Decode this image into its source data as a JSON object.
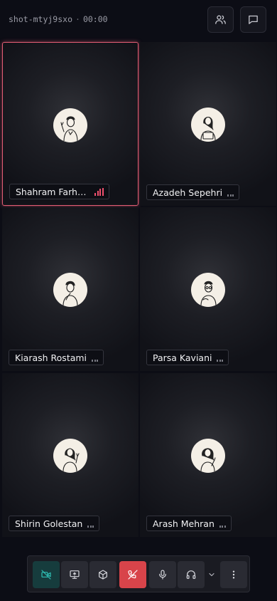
{
  "header": {
    "meeting_id": "shot-mtyj9sxo",
    "separator": "·",
    "elapsed": "00:00",
    "participants_button_icon": "users-icon",
    "chat_button_icon": "chat-bubble-icon"
  },
  "participants": [
    {
      "name": "Shahram Farhadi",
      "display": "Shahram Farha...",
      "speaking": true,
      "audio_level": 0.75,
      "avatar": "man-waving-illustration"
    },
    {
      "name": "Azadeh Sepehri",
      "display": "Azadeh Sepehri",
      "speaking": false,
      "audio_level": 0,
      "avatar": "woman-with-laptop-illustration"
    },
    {
      "name": "Kiarash Rostami",
      "display": "Kiarash Rostami",
      "speaking": false,
      "audio_level": 0,
      "avatar": "man-thinking-illustration"
    },
    {
      "name": "Parsa Kaviani",
      "display": "Parsa Kaviani",
      "speaking": false,
      "audio_level": 0,
      "avatar": "man-with-glasses-illustration"
    },
    {
      "name": "Shirin Golestan",
      "display": "Shirin Golestan",
      "speaking": false,
      "audio_level": 0,
      "avatar": "woman-waving-illustration"
    },
    {
      "name": "Arash Mehran",
      "display": "Arash Mehran",
      "speaking": false,
      "audio_level": 0,
      "avatar": "woman-pointing-illustration"
    }
  ],
  "controls": {
    "camera": {
      "icon": "video-off-icon",
      "state": "off"
    },
    "share_screen": {
      "icon": "screen-share-icon"
    },
    "three_d": {
      "icon": "cube-icon"
    },
    "hang_up": {
      "icon": "phone-hangup-icon"
    },
    "microphone": {
      "icon": "microphone-icon"
    },
    "audio_output": {
      "icon": "headphones-icon"
    },
    "audio_menu": {
      "icon": "chevron-down-icon"
    },
    "more": {
      "icon": "more-vertical-icon"
    }
  },
  "colors": {
    "speaking_border": "#e35d74",
    "speaking_signal": "#f0506e",
    "camera_off_bg": "#163c3d",
    "camera_off_icon": "#2fc0b5",
    "hang_up_bg": "#d8444a"
  }
}
